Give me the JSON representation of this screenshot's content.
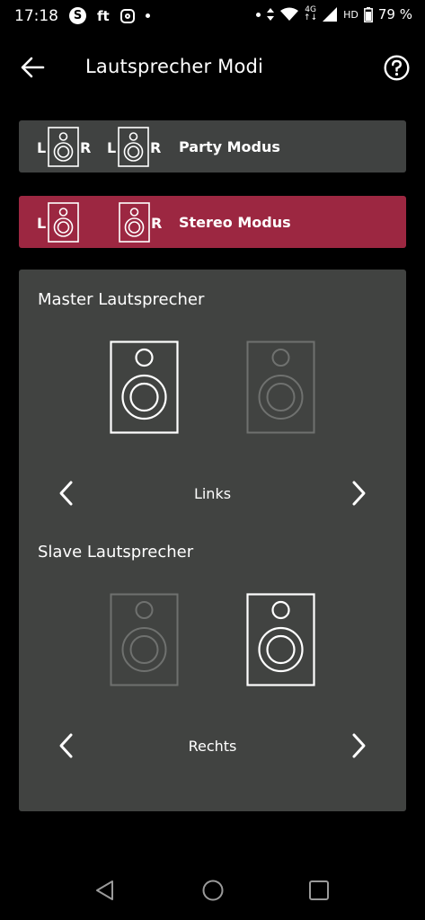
{
  "status_bar": {
    "time": "17:18",
    "app_icons": [
      "skype-icon",
      "ft-icon",
      "instagram-icon",
      "notification-dot-icon"
    ],
    "ft_text": "ft",
    "network": "4G",
    "hd": "HD",
    "battery": "79 %"
  },
  "header": {
    "title": "Lautsprecher Modi"
  },
  "modes": {
    "party": {
      "label": "Party Modus",
      "letters": [
        "L",
        "R",
        "L",
        "R"
      ],
      "selected": false
    },
    "stereo": {
      "label": "Stereo Modus",
      "letters": [
        "L",
        "R"
      ],
      "selected": true
    }
  },
  "master": {
    "title": "Master Lautsprecher",
    "value": "Links",
    "active_side": "left"
  },
  "slave": {
    "title": "Slave Lautsprecher",
    "value": "Rechts",
    "active_side": "right"
  },
  "colors": {
    "background": "#000000",
    "card": "#404241",
    "accent": "#9c2741",
    "inactive_speaker": "#6f716f"
  }
}
